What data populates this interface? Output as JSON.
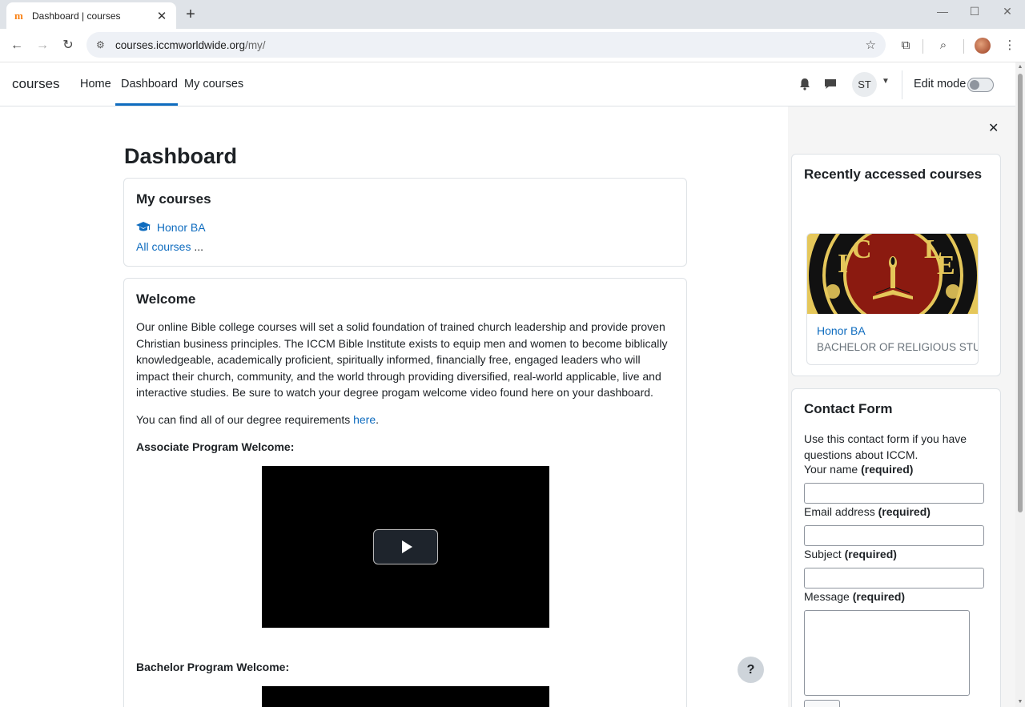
{
  "browser": {
    "tab_title": "Dashboard | courses",
    "tab_favicon": "m",
    "url_host": "courses.iccmworldwide.org",
    "url_path": "/my/"
  },
  "navbar": {
    "brand": "courses",
    "links": [
      "Home",
      "Dashboard",
      "My courses"
    ],
    "active": "Dashboard",
    "user_initials": "ST",
    "edit_mode_label": "Edit mode"
  },
  "main": {
    "page_title": "Dashboard",
    "my_courses": {
      "title": "My courses",
      "course_name": "Honor BA",
      "all_courses": "All courses",
      "ellipsis": "..."
    },
    "welcome": {
      "title": "Welcome",
      "paragraph": "Our online Bible college courses will set a solid foundation of trained church leadership and provide proven Christian business principles.  The ICCM Bible Institute exists to equip men and women to become biblically knowledgeable, academically proficient, spiritually informed, financially free, engaged leaders who will impact their church, community, and the world through providing diversified, real-world applicable, live and interactive studies.  Be sure to watch your degree progam welcome video found here on your dashboard.",
      "requirements_prefix": "You can find all of our degree requirements ",
      "requirements_link": "here",
      "requirements_suffix": ".",
      "associate_heading": "Associate Program Welcome:",
      "bachelor_heading": "Bachelor Program Welcome:"
    },
    "help_button": "?"
  },
  "drawer": {
    "recent": {
      "title": "Recently accessed courses",
      "course_name": "Honor BA",
      "course_category": "BACHELOR OF RELIGIOUS STU...",
      "image_letters": [
        "I",
        "C",
        "L",
        "E"
      ]
    },
    "contact": {
      "title": "Contact Form",
      "intro": "Use this contact form if you have questions about ICCM.",
      "fields": [
        {
          "label": "Your name",
          "required": "(required)"
        },
        {
          "label": "Email address",
          "required": "(required)"
        },
        {
          "label": "Subject",
          "required": "(required)"
        },
        {
          "label": "Message",
          "required": "(required)"
        }
      ]
    }
  },
  "colors": {
    "link": "#0f6cbf",
    "seal_red": "#8b1a10",
    "seal_gold": "#e5c75a"
  }
}
